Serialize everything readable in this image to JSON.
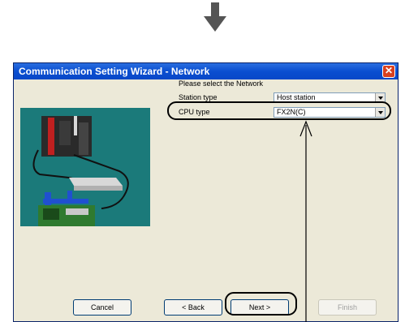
{
  "window": {
    "title": "Communication Setting Wizard - Network"
  },
  "form": {
    "heading": "Please select the Network",
    "station_type_label": "Station type",
    "station_type_value": "Host station",
    "cpu_type_label": "CPU type",
    "cpu_type_value": "FX2N(C)"
  },
  "buttons": {
    "cancel": "Cancel",
    "back": "< Back",
    "next": "Next >",
    "finish": "Finish"
  },
  "colors": {
    "titlebar": "#0a4ed0",
    "dialog_bg": "#ece9d8",
    "illustration_bg": "#1b7a7a"
  },
  "icons": [
    "down-arrow-icon",
    "close-icon",
    "dropdown-arrow-icon",
    "pointer-arrow-icon"
  ]
}
